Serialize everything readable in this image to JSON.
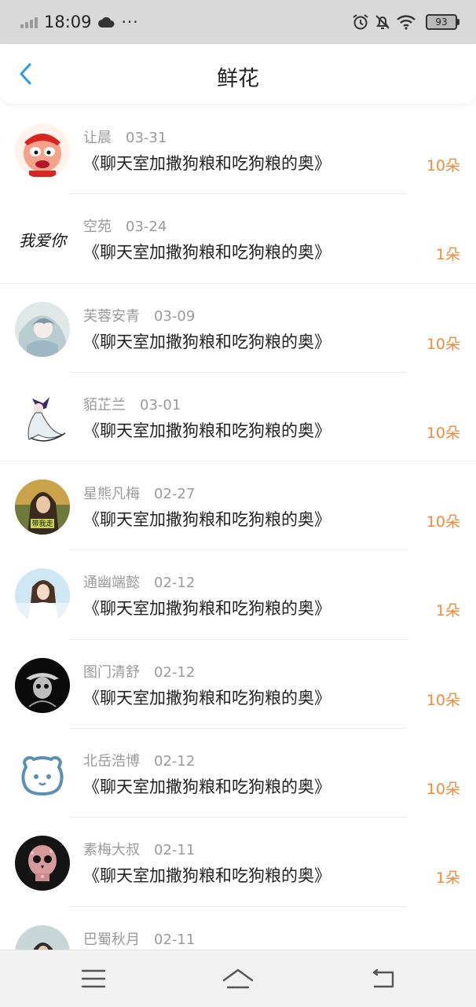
{
  "status_bar": {
    "time": "18:09",
    "more": "···",
    "battery": "93"
  },
  "header": {
    "title": "鲜花",
    "back_icon": "chevron-left-icon",
    "accent_color": "#2a9ae8"
  },
  "colors": {
    "count_color": "#f08a3b",
    "name_color": "#9a9a9a"
  },
  "list": {
    "items": [
      {
        "name": "让晨",
        "date": "03-31",
        "subject": "《聊天室加撒狗粮和吃狗粮的奥》",
        "count": "10朵",
        "avatar": "cartoon-face"
      },
      {
        "name": "空苑",
        "date": "03-24",
        "subject": "《聊天室加撒狗粮和吃狗粮的奥》",
        "count": "1朵",
        "avatar": "calligraphy",
        "avatar_text": "我爱你"
      },
      {
        "name": "芙蓉安青",
        "date": "03-09",
        "subject": "《聊天室加撒狗粮和吃狗粮的奥》",
        "count": "10朵",
        "avatar": "anime-painting"
      },
      {
        "name": "貊芷兰",
        "date": "03-01",
        "subject": "《聊天室加撒狗粮和吃狗粮的奥》",
        "count": "10朵",
        "avatar": "anime-figure"
      },
      {
        "name": "星熊凡梅",
        "date": "02-27",
        "subject": "《聊天室加撒狗粮和吃狗粮的奥》",
        "count": "10朵",
        "avatar": "photo-girl",
        "avatar_text": "带我走"
      },
      {
        "name": "通幽端懿",
        "date": "02-12",
        "subject": "《聊天室加撒狗粮和吃狗粮的奥》",
        "count": "1朵",
        "avatar": "photo-girl-sky"
      },
      {
        "name": "图门清舒",
        "date": "02-12",
        "subject": "《聊天室加撒狗粮和吃狗粮的奥》",
        "count": "10朵",
        "avatar": "dark-figure"
      },
      {
        "name": "北岳浩博",
        "date": "02-12",
        "subject": "《聊天室加撒狗粮和吃狗粮的奥》",
        "count": "10朵",
        "avatar": "bear-face"
      },
      {
        "name": "素梅大叔",
        "date": "02-11",
        "subject": "《聊天室加撒狗粮和吃狗粮的奥》",
        "count": "1朵",
        "avatar": "skull-flowers"
      },
      {
        "name": "巴蜀秋月",
        "date": "02-11",
        "subject": "",
        "count": "",
        "avatar": "photo-person"
      }
    ]
  },
  "nav_bar": {
    "menu_icon": "menu-icon",
    "home_icon": "home-icon",
    "back_icon": "back-icon"
  }
}
